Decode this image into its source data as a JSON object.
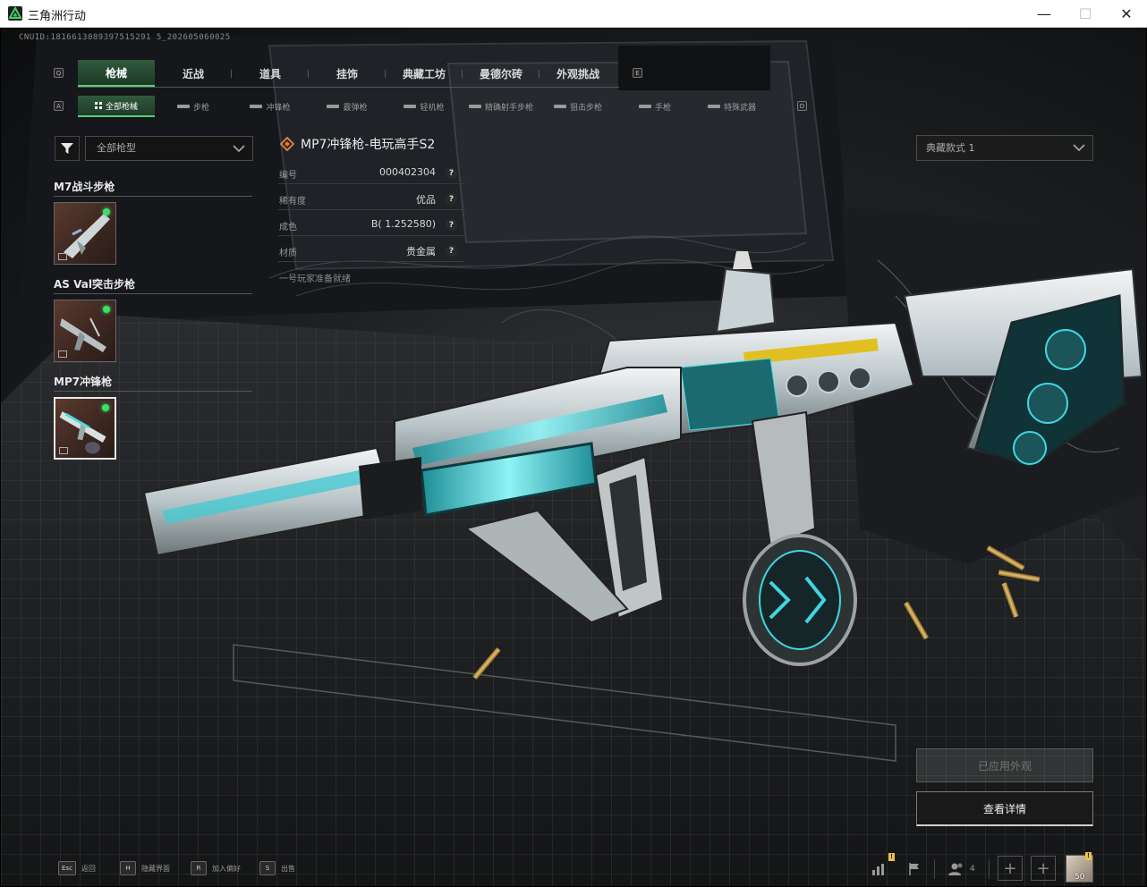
{
  "window": {
    "title": "三角洲行动",
    "minimize": "—",
    "maximize": "☐",
    "close": "✕"
  },
  "uid": "CNUID:1816613089397515291 5_202605060025",
  "main_tabs": [
    {
      "label": "枪械",
      "active": true
    },
    {
      "label": "近战",
      "active": false
    },
    {
      "label": "道具",
      "active": false
    },
    {
      "label": "挂饰",
      "active": false
    },
    {
      "label": "典藏工坊",
      "active": false
    },
    {
      "label": "曼德尔砖",
      "active": false
    },
    {
      "label": "外观挑战",
      "active": false
    }
  ],
  "main_tab_keys": {
    "left": "Q",
    "right": "E"
  },
  "sub_tabs": [
    {
      "label": "全部枪械",
      "active": true
    },
    {
      "label": "步枪",
      "active": false
    },
    {
      "label": "冲锋枪",
      "active": false
    },
    {
      "label": "霰弹枪",
      "active": false
    },
    {
      "label": "轻机枪",
      "active": false
    },
    {
      "label": "精确射手步枪",
      "active": false
    },
    {
      "label": "狙击步枪",
      "active": false
    },
    {
      "label": "手枪",
      "active": false
    },
    {
      "label": "特殊武器",
      "active": false
    }
  ],
  "sub_tab_keys": {
    "left": "A",
    "right": "D"
  },
  "filter": {
    "select_value": "全部枪型"
  },
  "weapon_groups": [
    {
      "title": "M7战斗步枪",
      "selected": false
    },
    {
      "title": "AS Val突击步枪",
      "selected": false
    },
    {
      "title": "MP7冲锋枪",
      "selected": true
    }
  ],
  "info": {
    "name": "MP7冲锋枪-电玩高手S2",
    "rows": [
      {
        "key": "编号",
        "value": "000402304"
      },
      {
        "key": "稀有度",
        "value": "优品"
      },
      {
        "key": "成色",
        "value": "B( 1.252580)"
      },
      {
        "key": "材质",
        "value": "贵金属"
      }
    ],
    "note": "一号玩家准备就绪",
    "help": "?"
  },
  "style_select": {
    "value": "典藏款式 1"
  },
  "buttons": {
    "applied": "已应用外观",
    "details": "查看详情"
  },
  "bottom_hints": [
    {
      "key": "Esc",
      "label": "返回"
    },
    {
      "key": "H",
      "label": "隐藏界面"
    },
    {
      "key": "R",
      "label": "加入偏好"
    },
    {
      "key": "S",
      "label": "出售"
    }
  ],
  "social": {
    "friends_count": "4",
    "avatar_level": "50",
    "notif_mark": "!"
  },
  "colors": {
    "accent_green": "#55d27a",
    "status_dot": "#39e06a",
    "notification": "#e8c24a",
    "weapon_teal": "#3fd6e0"
  }
}
